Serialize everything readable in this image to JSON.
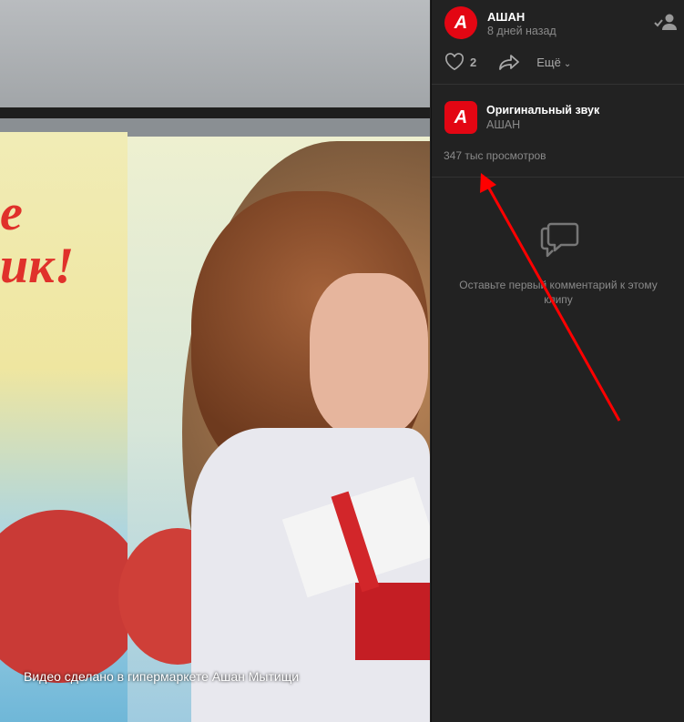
{
  "video": {
    "caption": "Видео сделано в гипермаркете Ашан Мытищи",
    "poster_text": "е\nик!"
  },
  "author": {
    "name": "АШАН",
    "date": "8 дней назад",
    "logo_icon": "auchan-logo"
  },
  "actions": {
    "likes": "2",
    "more_label": "Ещё"
  },
  "sound": {
    "title": "Оригинальный звук",
    "author": "АШАН"
  },
  "views": "347 тыс просмотров",
  "comments": {
    "empty_text": "Оставьте первый комментарий к этому клипу"
  },
  "colors": {
    "brand": "#e30613",
    "annotation": "#ff0000",
    "panel": "#222222"
  }
}
